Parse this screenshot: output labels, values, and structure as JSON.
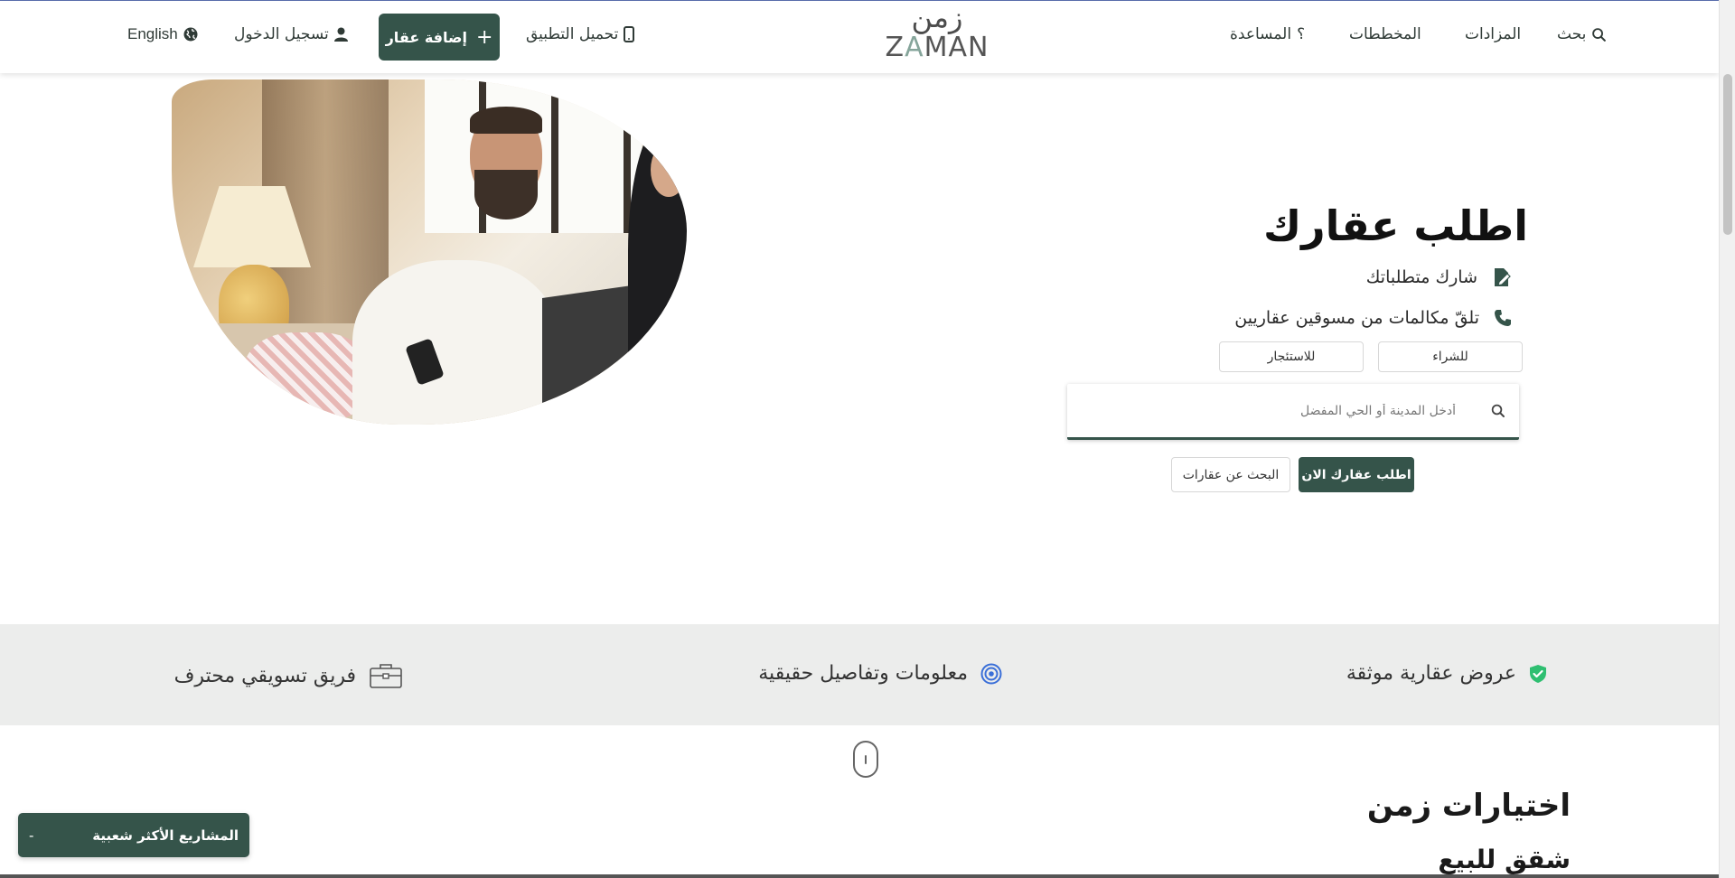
{
  "header": {
    "logo_ar": "زمن",
    "logo_en_a": "Z",
    "logo_en_b": "A",
    "logo_en_c": "MAN",
    "nav_search": "بحث",
    "nav_auctions": "المزادات",
    "nav_plans": "المخططات",
    "nav_help": "المساعدة",
    "download_app": "تحميل التطبيق",
    "add_property": "إضافة عقار",
    "login": "تسجيل الدخول",
    "language": "English"
  },
  "hero": {
    "title": "اطلب عقارك",
    "feature_1": "شارك متطلباتك",
    "feature_2": "تلقّ مكالمات من مسوقين عقاريين",
    "mode_buy": "للشراء",
    "mode_rent": "للاستئجار",
    "search_placeholder": "أدخل المدينة أو الحي المفضل",
    "cta_request": "اطلب عقارك الان",
    "cta_search": "البحث عن عقارات"
  },
  "features_band": {
    "item_1": "عروض عقارية موثقة",
    "item_2": "معلومات وتفاصيل حقيقية",
    "item_3": "فريق تسويقي محترف"
  },
  "picks": {
    "title": "اختيارات زمن",
    "subtitle": "شقق للبيع"
  },
  "popular_projects": {
    "label": "المشاريع الأكثر شعبية",
    "toggle": "-"
  },
  "colors": {
    "brand": "#35544a",
    "band_bg": "#ecedec",
    "verified_icon": "#2fbf71",
    "target_icon": "#3a6fd8"
  },
  "icons": {
    "search": "search-icon",
    "phone": "mobile-phone-icon",
    "plus": "plus-icon",
    "user": "user-icon",
    "globe": "globe-icon",
    "edit": "file-edit-icon",
    "call": "phone-icon",
    "verified": "shield-check-icon",
    "target": "target-icon",
    "briefcase": "briefcase-icon"
  }
}
